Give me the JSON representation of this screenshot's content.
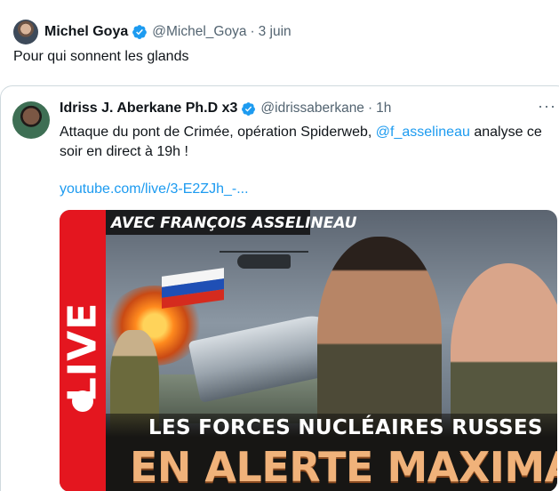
{
  "tweet": {
    "author_name": "Michel Goya",
    "author_handle": "@Michel_Goya",
    "separator": "·",
    "date": "3 juin",
    "text": "Pour qui sonnent les glands"
  },
  "quoted": {
    "author_name": "Idriss J. Aberkane Ph.D x3",
    "author_handle": "@idrissaberkane",
    "separator": "·",
    "time": "1h",
    "more": "···",
    "text_before": "Attaque du pont de Crimée, opération Spiderweb, ",
    "mention": "@f_asselineau",
    "text_after": " analyse ce soir en direct à 19h !",
    "link": "youtube.com/live/3-E2ZJh_-...",
    "thumbnail": {
      "live": "LIVE",
      "avec": "AVEC FRANÇOIS ASSELINEAU",
      "headline_top": "LES FORCES NUCLÉAIRES RUSSES",
      "headline_bottom": "EN ALERTE MAXIMALE"
    }
  },
  "colors": {
    "verified": "#1d9bf0",
    "link": "#1d9bf0",
    "secondary_text": "#536471",
    "live_red": "#e4161f"
  },
  "icons": [
    "verified-badge-icon",
    "more-options-icon"
  ]
}
